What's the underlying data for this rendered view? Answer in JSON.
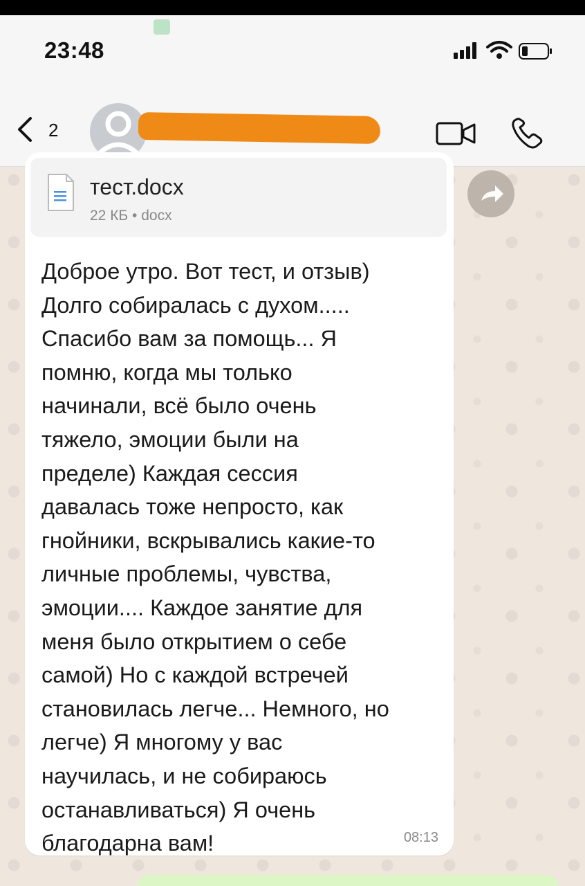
{
  "status_bar": {
    "time": "23:48"
  },
  "header": {
    "back_count": "2"
  },
  "attachment": {
    "file_name": "тест.docx",
    "file_meta": "22 КБ • docx"
  },
  "message": {
    "text": "Доброе утро. Вот тест, и отзыв)\nДолго собиралась с духом.....\nСпасибо вам за помощь... Я\nпомню, когда мы только\nначинали, всё было очень\nтяжело, эмоции были на\nпределе) Каждая сессия\nдавалась тоже непросто, как\nгнойники, вскрывались какие-то\nличные проблемы, чувства,\nэмоции.... Каждое занятие для\nменя было открытием о себе\nсамой) Но с каждой встречей\nстановилась легче... Немного, но\nлегче) Я многому у вас\nнаучилась, и не собираюсь\nостанавливаться)  Я очень\nблагодарна вам!",
    "time": "08:13"
  },
  "colors": {
    "redaction": "#f08a17",
    "bubble": "#ffffff",
    "outgoing_bubble": "#dcf7c5"
  },
  "icons": [
    "back-chevron-icon",
    "video-call-icon",
    "phone-icon",
    "document-icon",
    "forward-icon",
    "signal-icon",
    "wifi-icon",
    "battery-icon"
  ]
}
